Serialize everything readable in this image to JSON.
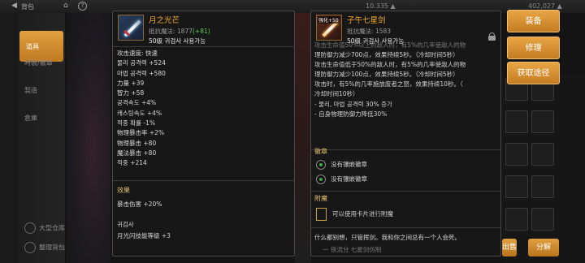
{
  "topbar": {
    "back_label": "背包",
    "currency_a": "10.335 ▲",
    "currency_b": "402,027 ▲"
  },
  "sidebar": {
    "items": [
      {
        "label": "道具"
      },
      {
        "label": "時裝/徽章"
      },
      {
        "label": "製造"
      },
      {
        "label": "倉庫"
      }
    ],
    "bottom": [
      {
        "label": "大型仓库"
      },
      {
        "label": "整理背包"
      }
    ]
  },
  "left_item": {
    "name": "月之光芒",
    "resist_label": "抵抗魔法: 1877",
    "resist_bonus": "(+81)",
    "class_req": "50级 귀검사 사용가능",
    "stats": [
      "攻击速度: 快速",
      "물리 공격력 +524",
      "마법 공격력 +580",
      "力量 +39",
      "智力 +58",
      "공격속도 +4%",
      "캐스팅속도 +4%",
      "적중 확률 -1%",
      "物理暴击率 +2%",
      "物理暴击 +80",
      "魔法暴击 +80",
      "적중 +214"
    ],
    "effect_title": "效果",
    "effect_line": "暴击伤害 +20%",
    "class_title": "귀검사",
    "skill_line": "月光闪技能等级 +3"
  },
  "right_item": {
    "name": "子午七星剑",
    "level_tag": "强化+50",
    "resist_label": "抵抗魔法: 1583",
    "class_req": "50级 귀검사 사용가능",
    "desc_lines": [
      "攻击生命值50%以上的敌人时，有5%的几率使敌人的物",
      "理防御力减少700点，效果持续5秒。（冷却时间5秒）",
      "攻击生命值低于50%的敌人时，有5%的几率使敌人的物",
      "理防御力减少100点，效果持续5秒。（冷却时间5秒）",
      "攻击时，有5%的几率施放废者之怒，效果持续10秒。（",
      "冷却时间10秒）",
      "- 물리, 마법 공격력 30% 증가",
      "- 自身物理防御力降低30%"
    ],
    "emblem_title": "徽章",
    "emblem_slots": [
      "没有镶嵌徽章",
      "没有镶嵌徽章"
    ],
    "enchant_title": "附魔",
    "enchant_line": "可以使用卡片进行附魔",
    "flavor_line": "什么都别想，只管挥剑。我和你之间总有一个人会死。",
    "flavor_line2": "一 铁流分 七星剑仿制"
  },
  "actions": {
    "equip": "装备",
    "repair": "修理",
    "obtain": "获取途径"
  },
  "bottom_buttons": {
    "sell": "出售",
    "disassemble": "分解"
  }
}
